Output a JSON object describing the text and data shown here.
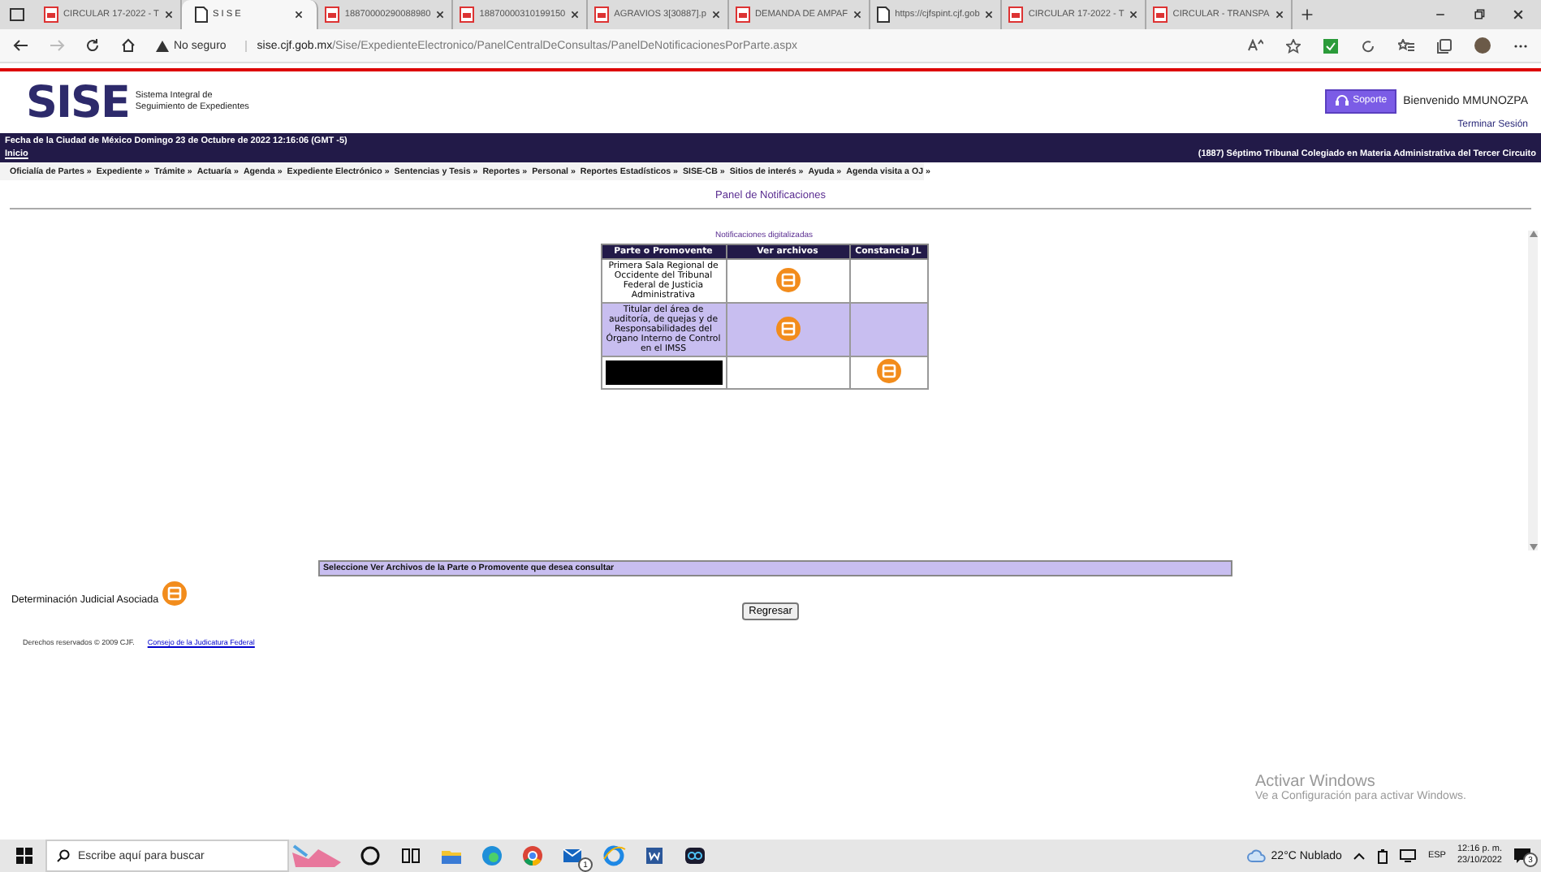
{
  "browser": {
    "tabs": [
      {
        "label": "CIRCULAR 17-2022 - T",
        "kind": "pdf",
        "selected": false
      },
      {
        "label": "S I S E",
        "kind": "page",
        "selected": true
      },
      {
        "label": "18870000290088980",
        "kind": "pdf",
        "selected": false
      },
      {
        "label": "18870000310199150",
        "kind": "pdf",
        "selected": false
      },
      {
        "label": "AGRAVIOS 3[30887].p",
        "kind": "pdf",
        "selected": false
      },
      {
        "label": "DEMANDA DE AMPAF",
        "kind": "pdf",
        "selected": false
      },
      {
        "label": "https://cjfspint.cjf.gob",
        "kind": "page",
        "selected": false
      },
      {
        "label": "CIRCULAR 17-2022 - T",
        "kind": "pdf",
        "selected": false
      },
      {
        "label": "CIRCULAR - TRANSPA",
        "kind": "pdf",
        "selected": false
      }
    ],
    "address": {
      "security": "No seguro",
      "url": "sise.cjf.gob.mx/Sise/ExpedienteElectronico/PanelCentralDeConsultas/PanelDeNotificacionesPorParte.aspx"
    }
  },
  "header": {
    "logo": "SISE",
    "subtitle": [
      "Sistema Integral de",
      "Seguimiento de Expedientes"
    ],
    "support_button": "Soporte",
    "welcome": "Bienvenido MMUNOZPA",
    "logout": "Terminar Sesión"
  },
  "info_bar": {
    "date": "Fecha de la Ciudad de México Domingo 23 de Octubre de 2022 12:16:06 (GMT -5)",
    "home_link": "Inicio",
    "court": "(1887) Séptimo Tribunal Colegiado en Materia Administrativa del Tercer Circuito"
  },
  "menu": [
    "Oficialía de Partes »",
    "Expediente »",
    "Trámite »",
    "Actuaría »",
    "Agenda »",
    "Expediente Electrónico »",
    "Sentencias y Tesis »",
    "Reportes »",
    "Personal »",
    "Reportes Estadísticos »",
    "SISE-CB »",
    "Sitios de interés »",
    "Ayuda »",
    "Agenda visita a OJ »"
  ],
  "panel": {
    "title": "Panel de Notificaciones",
    "table": {
      "caption": "Notificaciones digitalizadas",
      "columns": [
        "Parte o Promovente",
        "Ver archivos",
        "Constancia JL"
      ],
      "rows": [
        {
          "party": "Primera Sala Regional de Occidente del Tribunal Federal de Justicia Administrativa",
          "redacted": false,
          "shaded": false,
          "files": true,
          "constancia": false
        },
        {
          "party": "Titular del área de auditoría, de quejas y de Responsabilidades del Órgano Interno de Control en el IMSS",
          "redacted": false,
          "shaded": true,
          "files": true,
          "constancia": false
        },
        {
          "redacted": true,
          "shaded": false,
          "files": false,
          "constancia": true
        }
      ]
    },
    "hint": "Seleccione Ver Archivos de la Parte o Promovente que desea consultar",
    "associated": "Determinación Judicial Asociada",
    "back_button": "Regresar"
  },
  "footer": {
    "copyright": "Derechos reservados © 2009 CJF.",
    "link": "Consejo de la Judicatura Federal"
  },
  "activation": {
    "title": "Activar Windows",
    "text": "Ve a Configuración para activar Windows."
  },
  "taskbar": {
    "search_placeholder": "Escribe aquí para buscar",
    "apps": [
      {
        "kind": "cortana"
      },
      {
        "kind": "taskview"
      },
      {
        "kind": "folder"
      },
      {
        "kind": "edge"
      },
      {
        "kind": "chrome"
      },
      {
        "kind": "mail",
        "badge": "1"
      },
      {
        "kind": "ie"
      },
      {
        "kind": "word"
      },
      {
        "kind": "teams"
      }
    ],
    "weather": "22°C Nublado",
    "language": "ESP",
    "time": "12:16 p. m.",
    "date": "23/10/2022",
    "notifications": "3"
  }
}
